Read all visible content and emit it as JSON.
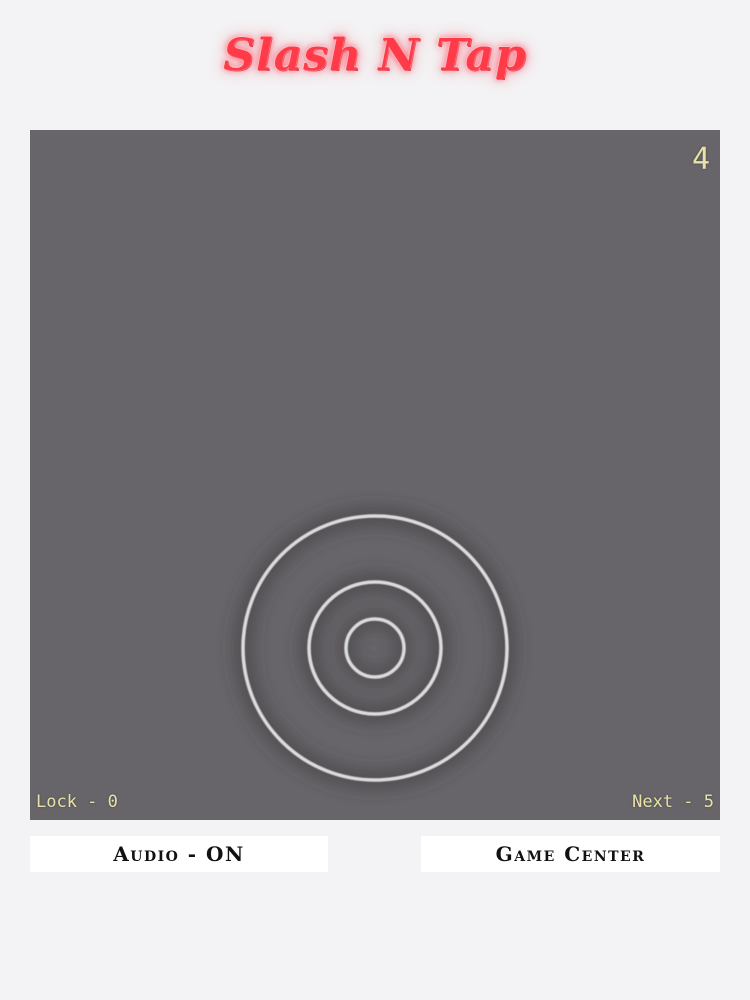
{
  "title": "Slash N Tap",
  "board": {
    "level": "4",
    "lock_label": "Lock - 0",
    "next_label": "Next - 5",
    "background_color": "#676569",
    "ring_color": "#dcdcdc"
  },
  "buttons": {
    "audio_label": "Audio - ON",
    "game_center_label": "Game Center"
  },
  "colors": {
    "title": "#ff3b4a",
    "page_background": "#f3f2f4",
    "hud_text": "#e9e2a6"
  }
}
